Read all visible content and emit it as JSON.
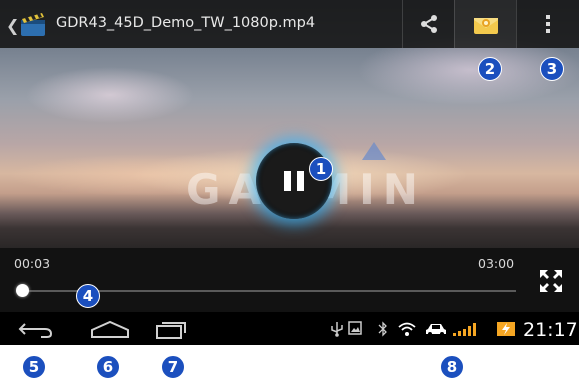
{
  "topbar": {
    "title": "GDR43_45D_Demo_TW_1080p.mp4",
    "share_icon": "share-icon",
    "inbox_icon": "inbox-icon",
    "more_icon": "overflow-menu-icon"
  },
  "video": {
    "watermark": "GARMIN",
    "state": "playing"
  },
  "controls": {
    "current_time": "00:03",
    "total_time": "03:00",
    "progress": 0.0
  },
  "statusbar": {
    "clock": "21:17",
    "icons": [
      "usb-icon",
      "image-icon",
      "bluetooth-icon",
      "wifi-icon",
      "car-icon",
      "signal-icon",
      "battery-charging-icon"
    ]
  },
  "navbar": {
    "icons": [
      "back-icon",
      "home-icon",
      "recent-apps-icon"
    ]
  },
  "callouts": [
    "1",
    "2",
    "3",
    "4",
    "5",
    "6",
    "7",
    "8"
  ],
  "colors": {
    "callout": "#1b4fbe",
    "glow": "#28b4ff",
    "battery": "#f5a623",
    "signal": "#f5a623"
  }
}
